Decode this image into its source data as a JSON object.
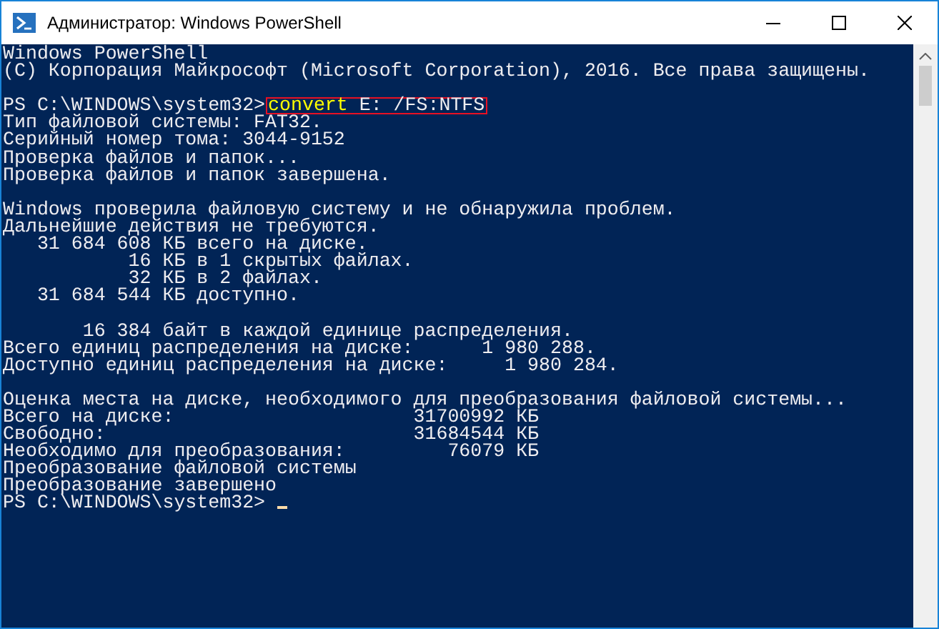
{
  "window": {
    "title": "Администратор: Windows PowerShell"
  },
  "console": {
    "lines": [
      {
        "kind": "output",
        "text": "Windows PowerShell"
      },
      {
        "kind": "output",
        "text": "(C) Корпорация Майкрософт (Microsoft Corporation), 2016. Все права защищены."
      },
      {
        "kind": "blank"
      },
      {
        "kind": "prompt",
        "prompt": "PS C:\\WINDOWS\\system32>",
        "command": "convert",
        "arguments": " E: /FS:NTFS",
        "highlighted": true
      },
      {
        "kind": "output",
        "text": "Тип файловой системы: FAT32."
      },
      {
        "kind": "output",
        "text": "Серийный номер тома: 3044-9152"
      },
      {
        "kind": "output",
        "text": "Проверка файлов и папок..."
      },
      {
        "kind": "output",
        "text": "Проверка файлов и папок завершена."
      },
      {
        "kind": "blank"
      },
      {
        "kind": "output",
        "text": "Windows проверила файловую систему и не обнаружила проблем."
      },
      {
        "kind": "output",
        "text": "Дальнейшие действия не требуются."
      },
      {
        "kind": "output",
        "text": "   31 684 608 КБ всего на диске."
      },
      {
        "kind": "output",
        "text": "           16 КБ в 1 скрытых файлах."
      },
      {
        "kind": "output",
        "text": "           32 КБ в 2 файлах."
      },
      {
        "kind": "output",
        "text": "   31 684 544 КБ доступно."
      },
      {
        "kind": "blank"
      },
      {
        "kind": "output",
        "text": "       16 384 байт в каждой единице распределения."
      },
      {
        "kind": "output",
        "text": "Всего единиц распределения на диске:      1 980 288."
      },
      {
        "kind": "output",
        "text": "Доступно единиц распределения на диске:     1 980 284."
      },
      {
        "kind": "blank"
      },
      {
        "kind": "output",
        "text": "Оценка места на диске, необходимого для преобразования файловой системы..."
      },
      {
        "kind": "output",
        "text": "Всего на диске:                     31700992 КБ"
      },
      {
        "kind": "output",
        "text": "Свободно:                           31684544 КБ"
      },
      {
        "kind": "output",
        "text": "Необходимо для преобразования:         76079 КБ"
      },
      {
        "kind": "output",
        "text": "Преобразование файловой системы"
      },
      {
        "kind": "output",
        "text": "Преобразование завершено"
      },
      {
        "kind": "prompt",
        "prompt": "PS C:\\WINDOWS\\system32>",
        "cursor": true
      }
    ]
  }
}
